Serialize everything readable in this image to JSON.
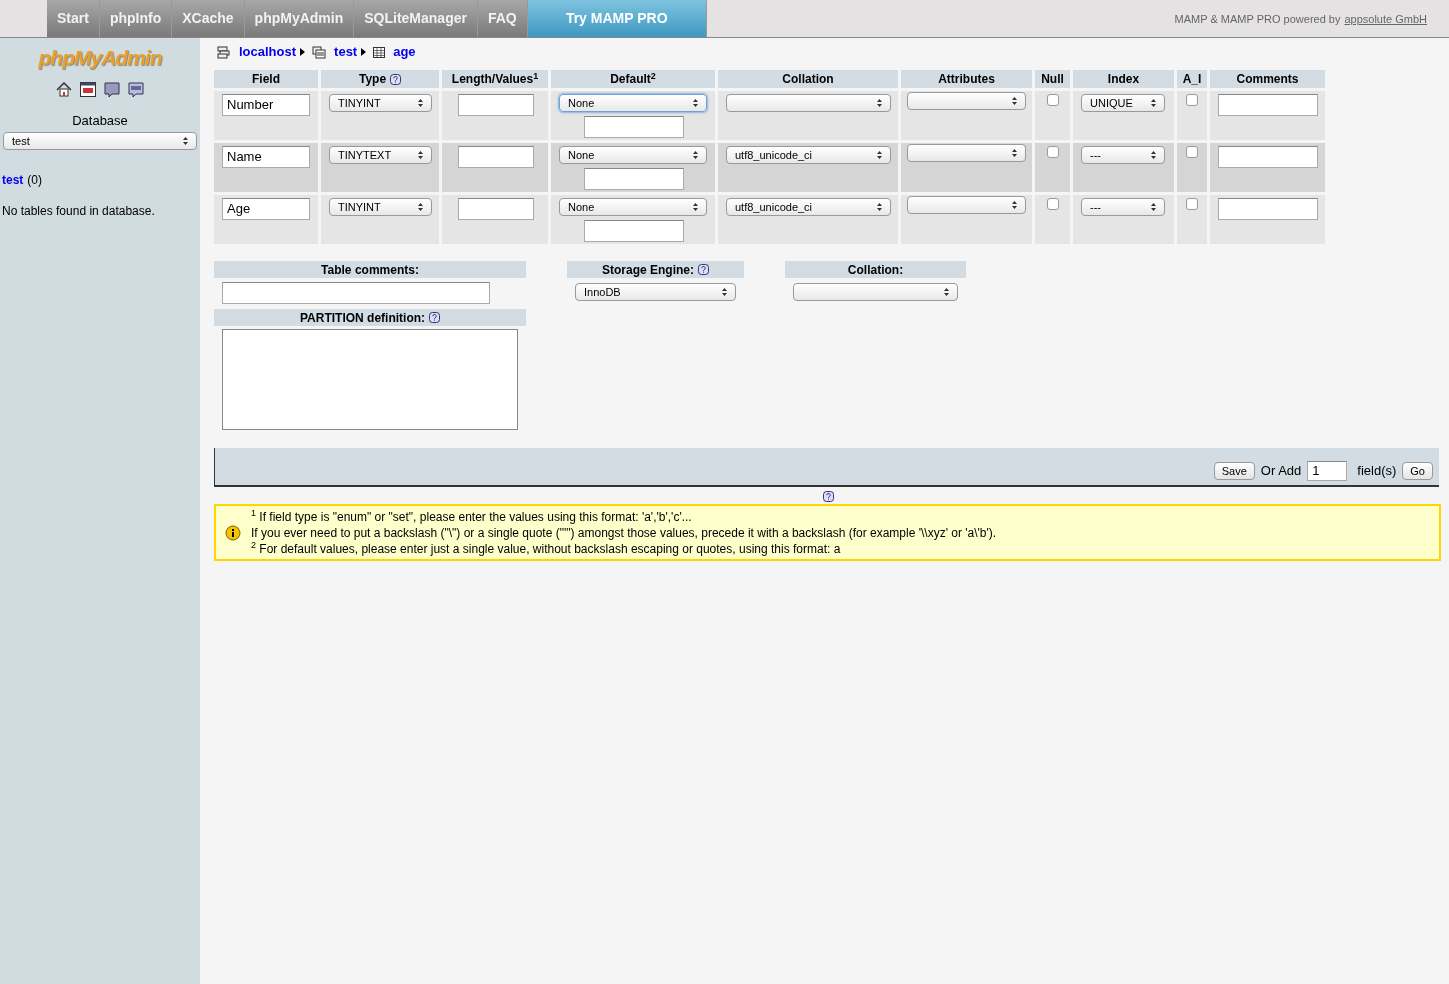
{
  "top_nav": {
    "tabs": [
      {
        "label": "Start",
        "kind": "tab"
      },
      {
        "label": "phpInfo",
        "kind": "tab"
      },
      {
        "label": "XCache",
        "kind": "tab"
      },
      {
        "label": "phpMyAdmin",
        "kind": "tab"
      },
      {
        "label": "SQLiteManager",
        "kind": "tab"
      },
      {
        "label": "FAQ",
        "kind": "tab"
      },
      {
        "label": "Try MAMP PRO",
        "kind": "promo"
      }
    ],
    "credit": "MAMP & MAMP PRO powered by",
    "credit_link": "appsolute GmbH"
  },
  "sidebar": {
    "logo": "phpMyAdmin",
    "database_label": "Database",
    "database_select": "test",
    "database_link": "test",
    "database_count": "(0)",
    "note": "No tables found in database."
  },
  "breadcrumb": [
    {
      "label": "localhost",
      "kind": "server"
    },
    {
      "label": "test",
      "kind": "database"
    },
    {
      "label": "age",
      "kind": "table"
    }
  ],
  "table": {
    "columns": [
      {
        "label": "Field",
        "help": false
      },
      {
        "label": "Type",
        "help": true
      },
      {
        "label": "Length/Values$^{1}$",
        "help": false
      },
      {
        "label": "Default$^{2}$",
        "help": false
      },
      {
        "label": "Collation",
        "help": false
      },
      {
        "label": "Attributes",
        "help": false
      },
      {
        "label": "Null",
        "help": false
      },
      {
        "label": "Index",
        "help": false
      },
      {
        "label": "A_I",
        "help": false
      },
      {
        "label": "Comments",
        "help": false
      }
    ],
    "rows": [
      {
        "field": "Number",
        "type": "TINYINT",
        "default": "None",
        "default_focused": true,
        "collation": "",
        "null": false,
        "index": "UNIQUE",
        "ai": false
      },
      {
        "field": "Name",
        "type": "TINYTEXT",
        "default": "None",
        "default_focused": false,
        "collation": "utf8_unicode_ci",
        "null": false,
        "index": "---",
        "ai": false
      },
      {
        "field": "Age",
        "type": "TINYINT",
        "default": "None",
        "default_focused": false,
        "collation": "utf8_unicode_ci",
        "null": false,
        "index": "---",
        "ai": false
      }
    ]
  },
  "options": {
    "table_comments_label": "Table comments:",
    "partition_label": "PARTITION definition:",
    "storage_engine_label": "Storage Engine:",
    "storage_engine": "InnoDB",
    "collation_label": "Collation:"
  },
  "footer": {
    "save": "Save",
    "or_add": "Or Add",
    "count": "1",
    "fields_label": "field(s)",
    "go": "Go"
  },
  "notes": [
    "$^{1}$ If field type is \"enum\" or \"set\", please enter the values using this format: 'a','b','c'...",
    "If you ever need to put a backslash (\"\\\") or a single quote (\"'\") amongst those values, precede it with a backslash (for example '\\\\xyz' or 'a\\'b').",
    "$^{2}$ For default values, please enter just a single value, without backslash escaping or quotes, using this format: a"
  ]
}
